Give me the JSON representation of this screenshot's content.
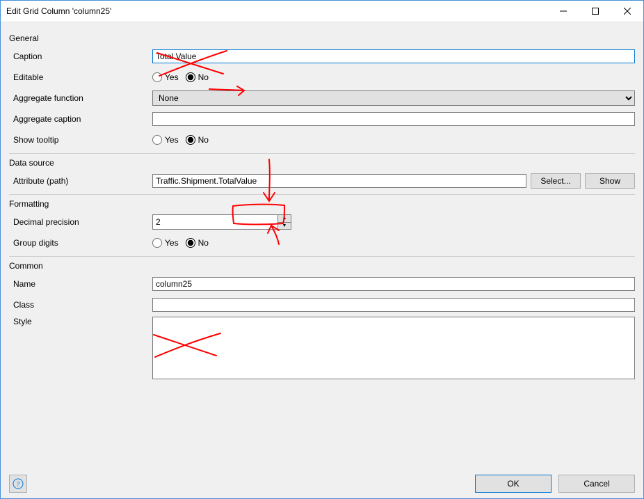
{
  "window_title": "Edit Grid Column 'column25'",
  "sections": {
    "general": {
      "title": "General",
      "caption_label": "Caption",
      "caption_value": "Total Value",
      "editable_label": "Editable",
      "editable_yes": "Yes",
      "editable_no": "No",
      "editable_selected": "No",
      "aggfn_label": "Aggregate function",
      "aggfn_value": "None",
      "aggcap_label": "Aggregate caption",
      "aggcap_value": "",
      "tooltip_label": "Show tooltip",
      "tooltip_yes": "Yes",
      "tooltip_no": "No",
      "tooltip_selected": "No"
    },
    "data_source": {
      "title": "Data source",
      "attr_label": "Attribute (path)",
      "attr_value": "Traffic.Shipment.TotalValue",
      "select_btn": "Select...",
      "show_btn": "Show"
    },
    "formatting": {
      "title": "Formatting",
      "precision_label": "Decimal precision",
      "precision_value": "2",
      "group_label": "Group digits",
      "group_yes": "Yes",
      "group_no": "No",
      "group_selected": "No"
    },
    "common": {
      "title": "Common",
      "name_label": "Name",
      "name_value": "column25",
      "class_label": "Class",
      "class_value": "",
      "style_label": "Style",
      "style_value": ""
    }
  },
  "footer": {
    "ok": "OK",
    "cancel": "Cancel"
  },
  "annotations": [
    {
      "type": "cross",
      "target": "caption_value"
    },
    {
      "type": "arrow_to_no",
      "target": "editable_no"
    },
    {
      "type": "arrow_down",
      "target": "attr_totalvalue"
    },
    {
      "type": "box",
      "target": "attr_totalvalue"
    },
    {
      "type": "arrow_up",
      "target": "attr_totalvalue"
    },
    {
      "type": "cross",
      "target": "name_value"
    }
  ]
}
